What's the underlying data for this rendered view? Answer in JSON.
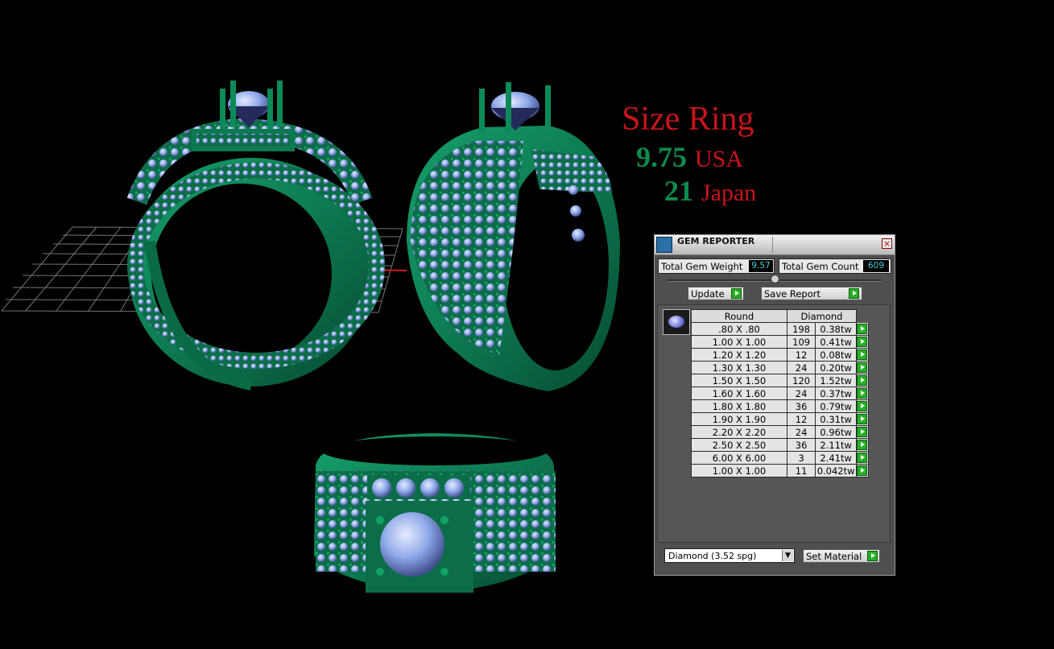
{
  "size_ring": {
    "title": "Size Ring",
    "usa_value": "9.75",
    "usa_unit": "USA",
    "japan_value": "21",
    "japan_unit": "Japan"
  },
  "gem_reporter": {
    "title": "GEM REPORTER",
    "close_label": "×",
    "total_gem_weight_label": "Total Gem Weight",
    "total_gem_weight_value": "9.57",
    "total_gem_count_label": "Total Gem Count",
    "total_gem_count_value": "609",
    "update_label": "Update",
    "save_report_label": "Save Report",
    "columns": {
      "shape": "Round",
      "material": "Diamond"
    },
    "rows": [
      {
        "size": ".80 X .80",
        "count": "198",
        "weight": "0.38tw"
      },
      {
        "size": "1.00 X 1.00",
        "count": "109",
        "weight": "0.41tw"
      },
      {
        "size": "1.20 X 1.20",
        "count": "12",
        "weight": "0.08tw"
      },
      {
        "size": "1.30 X 1.30",
        "count": "24",
        "weight": "0.20tw"
      },
      {
        "size": "1.50 X 1.50",
        "count": "120",
        "weight": "1.52tw"
      },
      {
        "size": "1.60 X 1.60",
        "count": "24",
        "weight": "0.37tw"
      },
      {
        "size": "1.80 X 1.80",
        "count": "36",
        "weight": "0.79tw"
      },
      {
        "size": "1.90 X 1.90",
        "count": "12",
        "weight": "0.31tw"
      },
      {
        "size": "2.20 X 2.20",
        "count": "24",
        "weight": "0.96tw"
      },
      {
        "size": "2.50 X 2.50",
        "count": "36",
        "weight": "2.11tw"
      },
      {
        "size": "6.00 X 6.00",
        "count": "3",
        "weight": "2.41tw"
      },
      {
        "size": "1.00 X 1.00",
        "count": "11",
        "weight": "0.042tw"
      }
    ],
    "material_select_value": "Diamond    (3.52 spg)",
    "set_material_label": "Set Material"
  },
  "colors": {
    "background": "#000000",
    "ring_metal": "#0d7a52",
    "gem_blue": "#8fa8e8",
    "title_red": "#c8141c",
    "size_green": "#0e8a4c"
  }
}
